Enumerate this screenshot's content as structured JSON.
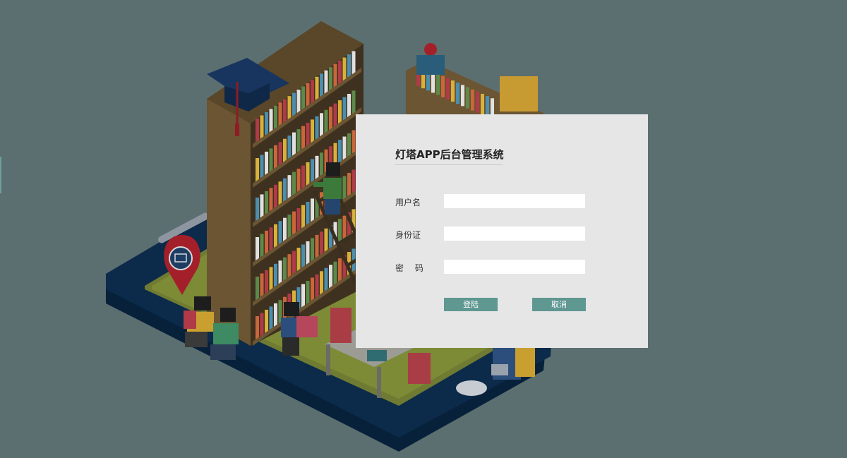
{
  "login": {
    "title": "灯塔APP后台管理系统",
    "fields": [
      {
        "label": "用户名",
        "value": "",
        "type": "text"
      },
      {
        "label": "身份证",
        "value": "",
        "type": "text"
      },
      {
        "label": "密 码",
        "value": "",
        "type": "password"
      }
    ],
    "login_label": "登陆",
    "cancel_label": "取消"
  },
  "colors": {
    "background": "#5c6f70",
    "panel": "#e6e6e6",
    "button": "#5f9791",
    "phone_body": "#0c2a4a",
    "floor": "#7d8a36",
    "shelf": "#6b5532",
    "pin": "#a3202a"
  },
  "illustration": {
    "description_icon": "isometric-library-on-phone"
  }
}
